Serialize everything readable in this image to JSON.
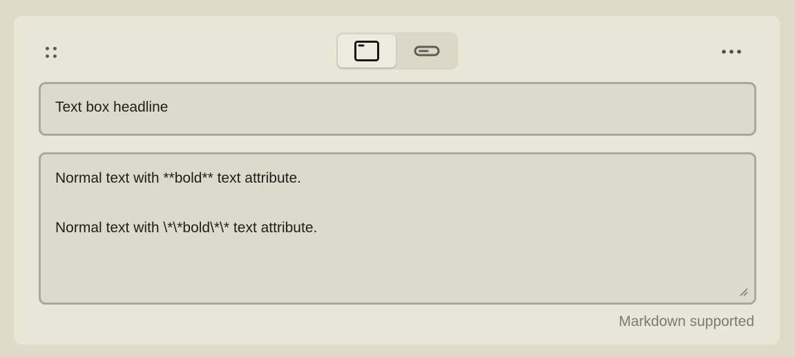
{
  "editor": {
    "headline_value": "Text box headline",
    "body_lines": [
      "Normal text with **bold** text attribute.",
      "",
      "Normal text with \\*\\*bold\\*\\* text attribute."
    ],
    "hint": "Markdown supported"
  },
  "toolbar": {
    "drag_handle_icon": "drag-dots-icon",
    "modes": [
      {
        "icon": "card-window-icon",
        "selected": true
      },
      {
        "icon": "inline-bar-icon",
        "selected": false
      }
    ],
    "more_icon": "more-horizontal-icon"
  },
  "colors": {
    "background": "#dedbc8",
    "card": "#e8e6d6",
    "field": "#dcdacb",
    "field_border": "#a8a79a",
    "text": "#1e1e1a",
    "hint_text": "#7b7a70"
  }
}
